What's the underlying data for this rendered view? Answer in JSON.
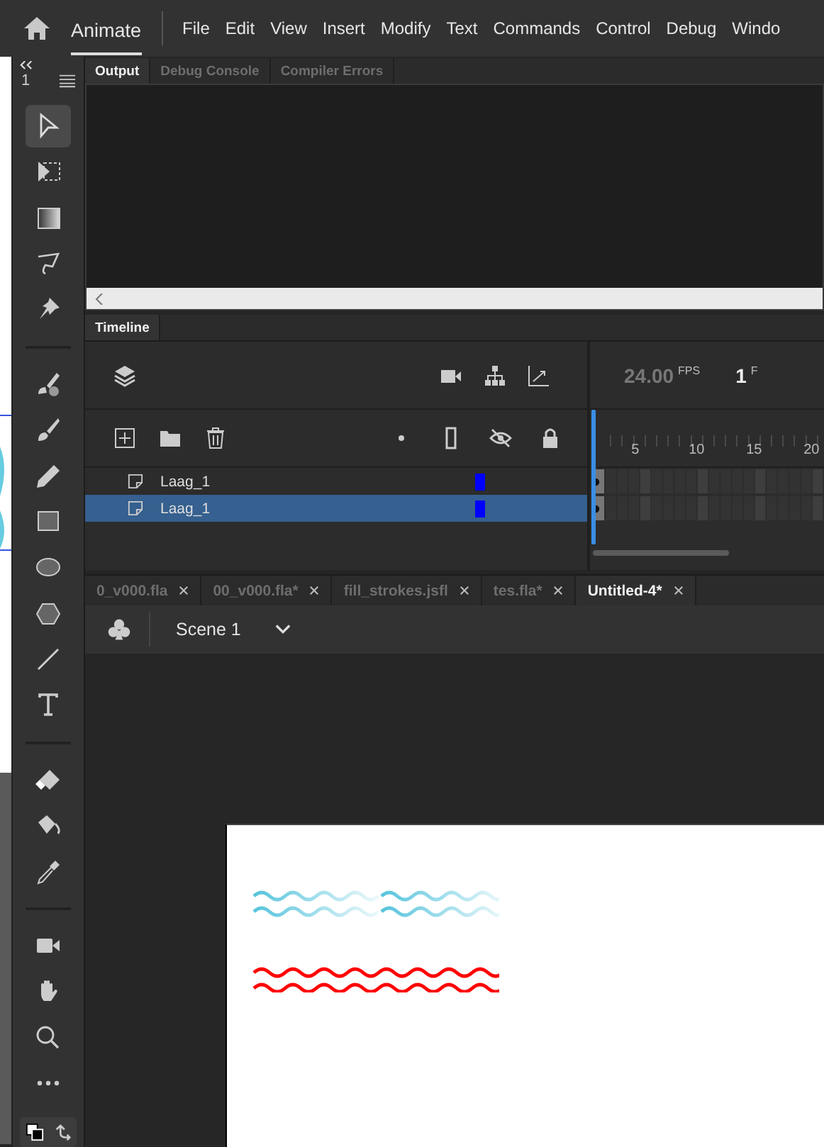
{
  "app": {
    "name": "Animate"
  },
  "menu": [
    "File",
    "Edit",
    "View",
    "Insert",
    "Modify",
    "Text",
    "Commands",
    "Control",
    "Debug",
    "Windo"
  ],
  "toolbar": {
    "panel_number": "1"
  },
  "tools": [
    {
      "kind": "select",
      "selected": true
    },
    {
      "kind": "transform",
      "selected": false
    },
    {
      "kind": "gradient",
      "selected": false
    },
    {
      "kind": "lasso",
      "selected": false
    },
    {
      "kind": "pin",
      "selected": false
    },
    {
      "kind": "separator"
    },
    {
      "kind": "paintbrush",
      "selected": false
    },
    {
      "kind": "brush",
      "selected": false
    },
    {
      "kind": "pencil",
      "selected": false
    },
    {
      "kind": "rectangle",
      "selected": false
    },
    {
      "kind": "oval",
      "selected": false
    },
    {
      "kind": "polystar",
      "selected": false
    },
    {
      "kind": "line",
      "selected": false
    },
    {
      "kind": "text",
      "selected": false
    },
    {
      "kind": "separator"
    },
    {
      "kind": "eraser",
      "selected": false
    },
    {
      "kind": "bucket",
      "selected": false
    },
    {
      "kind": "eyedropper",
      "selected": false
    },
    {
      "kind": "separator"
    },
    {
      "kind": "camera",
      "selected": false
    },
    {
      "kind": "hand",
      "selected": false
    },
    {
      "kind": "zoom",
      "selected": false
    },
    {
      "kind": "more",
      "selected": false
    }
  ],
  "output_panel": {
    "tabs": [
      {
        "label": "Output",
        "selected": true
      },
      {
        "label": "Debug Console",
        "selected": false
      },
      {
        "label": "Compiler Errors",
        "selected": false
      }
    ]
  },
  "timeline": {
    "tab": "Timeline",
    "fps": "24.00",
    "fps_unit": "FPS",
    "frame": "1",
    "frame_unit": "F",
    "ruler": [
      "5",
      "10",
      "15",
      "20"
    ],
    "layers": [
      {
        "name": "Laag_1",
        "color": "#0000ff",
        "selected": false
      },
      {
        "name": "Laag_1",
        "color": "#0000ff",
        "selected": true
      }
    ]
  },
  "documents": [
    {
      "label": "0_v000.fla",
      "selected": false
    },
    {
      "label": "00_v000.fla*",
      "selected": false
    },
    {
      "label": "fill_strokes.jsfl",
      "selected": false
    },
    {
      "label": "tes.fla*",
      "selected": false
    },
    {
      "label": "Untitled-4*",
      "selected": true
    }
  ],
  "scene": {
    "name": "Scene 1"
  }
}
